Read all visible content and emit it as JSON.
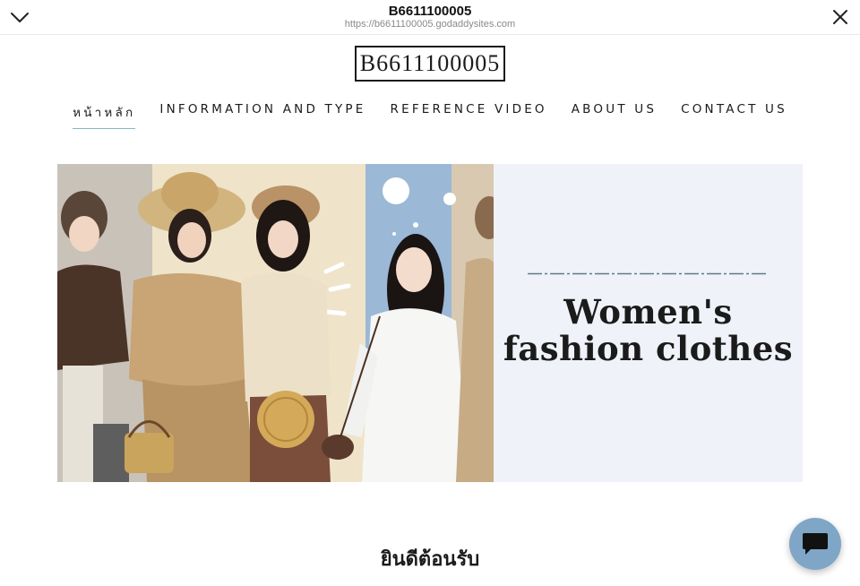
{
  "browser": {
    "title": "B6611100005",
    "url": "https://b6611100005.godaddysites.com"
  },
  "site": {
    "logo_text": "B6611100005"
  },
  "nav": {
    "items": [
      {
        "label": "หน้าหลัก",
        "active": true
      },
      {
        "label": "INFORMATION AND TYPE",
        "active": false
      },
      {
        "label": "REFERENCE VIDEO",
        "active": false
      },
      {
        "label": "ABOUT US",
        "active": false
      },
      {
        "label": "CONTACT US",
        "active": false
      }
    ]
  },
  "hero": {
    "headline": "Women's fashion clothes",
    "image": "women-fashion-photo-collage",
    "panel_color": "#eff2f8",
    "accent_color": "#8ab4c8"
  },
  "welcome": {
    "text": "ยินดีต้อนรับ"
  },
  "icons": {
    "collapse": "chevron-down-icon",
    "close": "close-icon",
    "chat": "chat-bubble-icon"
  },
  "colors": {
    "chat_button": "#7fa6c7"
  }
}
